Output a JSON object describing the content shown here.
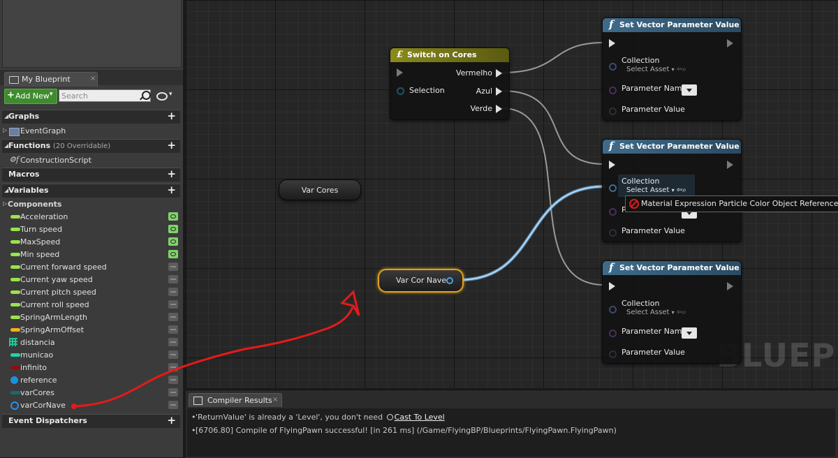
{
  "panel": {
    "tab_title": "My Blueprint",
    "tab_close": "×",
    "add_new_label": "Add New",
    "search_placeholder": "Search"
  },
  "sections": {
    "graphs": "Graphs",
    "functions": "Functions",
    "functions_sub": "(20 Overridable)",
    "macros": "Macros",
    "variables": "Variables",
    "components": "Components",
    "event_dispatchers": "Event Dispatchers"
  },
  "graph_items": [
    "EventGraph"
  ],
  "function_items": [
    "ConstructionScript"
  ],
  "variables": [
    {
      "label": "Acceleration",
      "color": "#9be34b",
      "visible": true
    },
    {
      "label": "Turn speed",
      "color": "#9be34b",
      "visible": true
    },
    {
      "label": "MaxSpeed",
      "color": "#9be34b",
      "visible": true
    },
    {
      "label": "Min speed",
      "color": "#9be34b",
      "visible": true
    },
    {
      "label": "Current forward speed",
      "color": "#9be34b",
      "visible": false
    },
    {
      "label": "Current yaw speed",
      "color": "#9be34b",
      "visible": false
    },
    {
      "label": "Current pitch speed",
      "color": "#9be34b",
      "visible": false
    },
    {
      "label": "Current roll speed",
      "color": "#9be34b",
      "visible": false
    },
    {
      "label": "SpringArmLength",
      "color": "#9be34b",
      "visible": false
    },
    {
      "label": "SpringArmOffset",
      "color": "#f2b01e",
      "visible": false
    },
    {
      "label": "distancia",
      "color": "#1fd6a6",
      "visible": false
    },
    {
      "label": "municao",
      "color": "#1fd6a6",
      "visible": false
    },
    {
      "label": "infinito",
      "color": "#8a1010",
      "visible": false
    },
    {
      "label": "reference",
      "color": "#1e8fe0",
      "visible": false
    },
    {
      "label": "varCores",
      "color": "#1a6a6a",
      "visible": false
    },
    {
      "label": "varCorNave",
      "color": "#2a8fe6",
      "visible": false
    }
  ],
  "graph": {
    "watermark": "BLUEPRINT",
    "switch_node": {
      "title": "Switch on Cores",
      "input_label": "Selection",
      "outputs": [
        "Vermelho",
        "Azul",
        "Verde"
      ]
    },
    "set_vector_nodes": [
      {
        "title": "Set Vector Parameter Value"
      },
      {
        "title": "Set Vector Parameter Value"
      },
      {
        "title": "Set Vector Parameter Value"
      }
    ],
    "pin_labels": {
      "collection": "Collection",
      "select_asset": "Select Asset",
      "parameter_name": "Parameter Name",
      "parameter_value": "Parameter Value",
      "parameter_name_partial": "P"
    },
    "var_cores_label": "Var Cores",
    "var_cor_nave_label": "Var Cor Nave",
    "tooltip": "Material Expression Particle Color Object Reference is not compatible with Material Parameter Collection Object Reference."
  },
  "compiler": {
    "tab_title": "Compiler Results",
    "tab_close": "×",
    "line1_text": "'ReturnValue' is already a 'Level', you don't need",
    "line1_link": "Cast To Level",
    "line2_text": "[6706.80] Compile of FlyingPawn successful! [in 261 ms] (/Game/FlyingBP/Blueprints/FlyingPawn.FlyingPawn)"
  },
  "colors": {
    "switch_header": "#7d7a18",
    "function_header": "#3f6b8a",
    "highlight_wire": "#8cc4f0",
    "annotation": "#e61a1a"
  }
}
